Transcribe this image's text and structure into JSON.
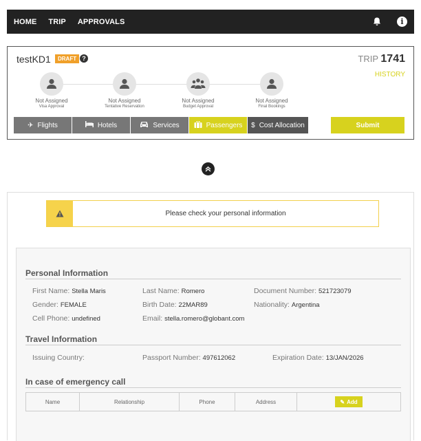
{
  "nav": {
    "items": [
      "HOME",
      "TRIP",
      "APPROVALS"
    ],
    "bell_icon": "bell-icon",
    "info_icon": "info-icon",
    "info_glyph": "i"
  },
  "trip": {
    "name": "testKD1",
    "badge": "DRAFT",
    "help_glyph": "?",
    "trip_prefix": "TRIP",
    "trip_number": "1741",
    "history_label": "HISTORY",
    "steps": [
      {
        "status": "Not Assigned",
        "label": "Visa Approval",
        "icon": "user-icon"
      },
      {
        "status": "Not Assigned",
        "label": "Tentative Reservation",
        "icon": "user-icon"
      },
      {
        "status": "Not Assigned",
        "label": "Budget Approval",
        "icon": "group-icon"
      },
      {
        "status": "Not Assigned",
        "label": "Final Bookings",
        "icon": "user-icon"
      }
    ],
    "tabs": [
      {
        "label": "Flights",
        "icon": "plane-icon",
        "glyph": "✈"
      },
      {
        "label": "Hotels",
        "icon": "bed-icon",
        "glyph": "🛏"
      },
      {
        "label": "Services",
        "icon": "car-icon",
        "glyph": "🚘"
      },
      {
        "label": "Passengers",
        "icon": "suitcase-icon",
        "glyph": "💼"
      },
      {
        "label": "Cost Allocation",
        "icon": "dollar-icon",
        "glyph": "$"
      }
    ],
    "submit_label": "Submit"
  },
  "collapse_glyph": "«",
  "alert": {
    "glyph": "⚠",
    "text": "Please check your personal information"
  },
  "personal": {
    "title": "Personal Information",
    "first_name_label": "First Name:",
    "first_name": "Stella Maris",
    "last_name_label": "Last Name:",
    "last_name": "Romero",
    "doc_label": "Document Number:",
    "doc_number": "521723079",
    "gender_label": "Gender:",
    "gender": "FEMALE",
    "birth_label": "Birth Date:",
    "birth_date": "22MAR89",
    "nationality_label": "Nationality:",
    "nationality": "Argentina",
    "cell_label": "Cell Phone:",
    "cell": "undefined",
    "email_label": "Email:",
    "email": "stella.romero@globant.com"
  },
  "travel": {
    "title": "Travel Information",
    "issuing_label": "Issuing Country:",
    "issuing": "",
    "passport_label": "Passport Number:",
    "passport": "497612062",
    "expiration_label": "Expiration Date:",
    "expiration": "13/JAN/2026"
  },
  "emergency": {
    "title": "In case of emergency call",
    "columns": [
      "Name",
      "Relationship",
      "Phone",
      "Address"
    ],
    "add_label": "Add",
    "add_glyph": "✎"
  },
  "colors": {
    "accent": "#d7d21e",
    "badge": "#f0a02a",
    "alert": "#f6d34b",
    "nav": "#222222"
  }
}
